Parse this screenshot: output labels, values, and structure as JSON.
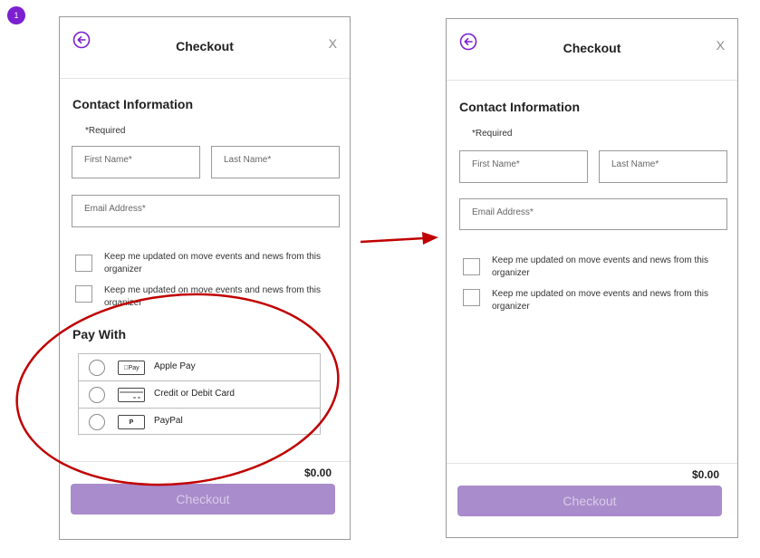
{
  "step_badge": "1",
  "screens": {
    "left": {
      "header": {
        "title": "Checkout",
        "close": "X"
      },
      "contact": {
        "title": "Contact Information",
        "required": "*Required",
        "first_name": "First Name*",
        "last_name": "Last Name*",
        "email": "Email Address*"
      },
      "options": [
        "Keep me updated on move events and news from this organizer",
        "Keep me updated on move events and news from this organizer"
      ],
      "pay_with": {
        "title": "Pay With",
        "methods": [
          {
            "icon_text": "Pay",
            "icon": "apple-pay-icon",
            "label": "Apple Pay"
          },
          {
            "icon_text": "",
            "icon": "credit-card-icon",
            "label": "Credit or Debit Card"
          },
          {
            "icon_text": "P",
            "icon": "paypal-icon",
            "label": "PayPal"
          }
        ]
      },
      "total": "$0.00",
      "checkout_button": "Checkout"
    },
    "right": {
      "header": {
        "title": "Checkout",
        "close": "X"
      },
      "contact": {
        "title": "Contact Information",
        "required": "*Required",
        "first_name": "First Name*",
        "last_name": "Last Name*",
        "email": "Email Address*"
      },
      "options": [
        "Keep me updated on move events and news from this organizer",
        "Keep me updated on move events and news from this organizer"
      ],
      "total": "$0.00",
      "checkout_button": "Checkout"
    }
  },
  "colors": {
    "badge": "#7b1fd1",
    "accent_purple": "#7b1fd1",
    "checkout_button": "#a98ccb",
    "annotation_red": "#c00000"
  }
}
